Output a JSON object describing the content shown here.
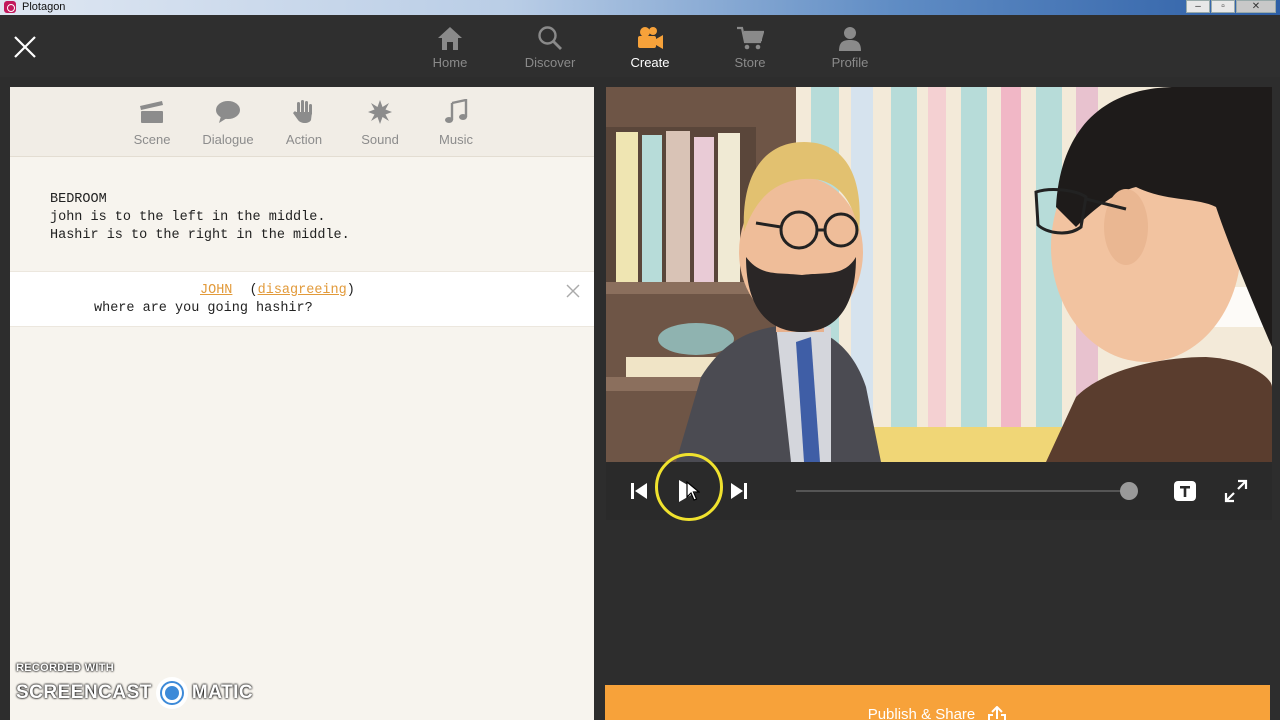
{
  "window": {
    "title": "Plotagon",
    "buttons": [
      "–",
      "▫",
      "✕"
    ]
  },
  "nav": {
    "items": [
      {
        "label": "Home",
        "icon": "home-icon",
        "active": false
      },
      {
        "label": "Discover",
        "icon": "search-icon",
        "active": false
      },
      {
        "label": "Create",
        "icon": "camera-icon",
        "active": true
      },
      {
        "label": "Store",
        "icon": "cart-icon",
        "active": false
      },
      {
        "label": "Profile",
        "icon": "person-icon",
        "active": false
      }
    ]
  },
  "tools": {
    "items": [
      {
        "label": "Scene",
        "icon": "clapperboard-icon"
      },
      {
        "label": "Dialogue",
        "icon": "speech-bubble-icon"
      },
      {
        "label": "Action",
        "icon": "hand-icon"
      },
      {
        "label": "Sound",
        "icon": "burst-icon"
      },
      {
        "label": "Music",
        "icon": "music-note-icon"
      }
    ]
  },
  "script": {
    "scene": {
      "location": "BEDROOM",
      "line1": "john is to the left in the middle.",
      "line2": "Hashir is to the right in the middle."
    },
    "dialogue": {
      "speaker": "JOHN",
      "open_paren": "(",
      "mood": "disagreeing",
      "close_paren": ")",
      "text": "where are you going hashir?"
    }
  },
  "player": {
    "progress": 1.0,
    "controls": [
      "skip-back-icon",
      "play-icon",
      "skip-forward-icon",
      "subtitles-icon",
      "fullscreen-icon"
    ]
  },
  "publish": {
    "label": "Publish & Share",
    "icon": "share-icon"
  },
  "watermark": {
    "small": "RECORDED WITH",
    "left": "SCREENCAST",
    "right": "MATIC"
  },
  "colors": {
    "accent": "#f7a23a",
    "link": "#e29a3a",
    "cursor_ring": "#f0e22e"
  }
}
